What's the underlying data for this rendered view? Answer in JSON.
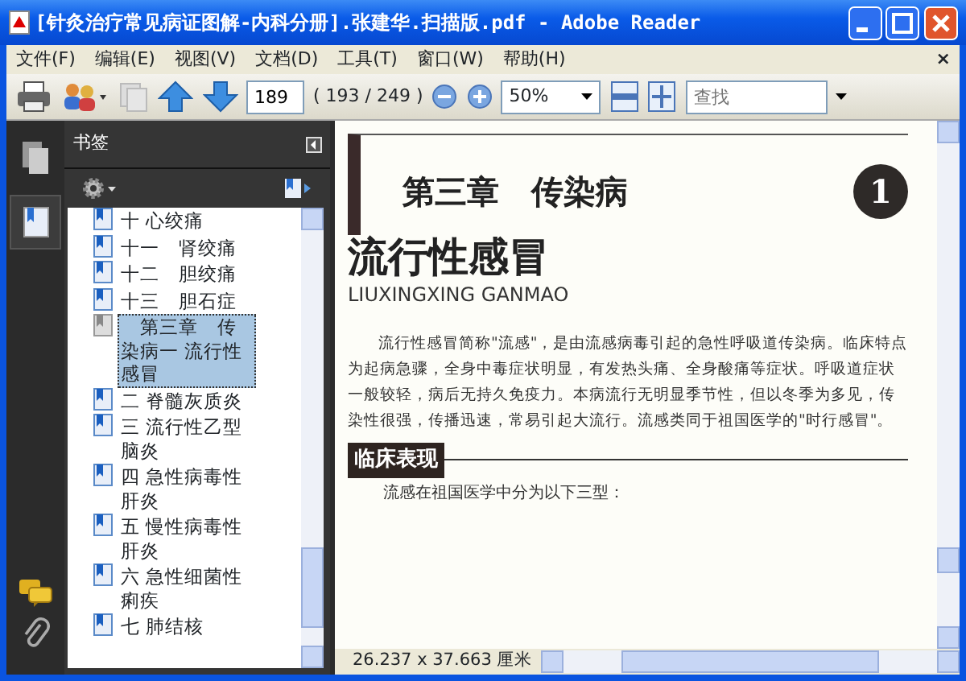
{
  "window": {
    "title": "[针灸治疗常见病证图解-内科分册].张建华.扫描版.pdf - Adobe Reader"
  },
  "menu": [
    {
      "label": "文件(F)"
    },
    {
      "label": "编辑(E)"
    },
    {
      "label": "视图(V)"
    },
    {
      "label": "文档(D)"
    },
    {
      "label": "工具(T)"
    },
    {
      "label": "窗口(W)"
    },
    {
      "label": "帮助(H)"
    }
  ],
  "menu_close": "×",
  "toolbar": {
    "page_field": {
      "value": "189"
    },
    "page_count": "( 193 / 249 )",
    "zoom": {
      "value": "50%"
    },
    "search": {
      "placeholder": "查找"
    }
  },
  "side_tabs": [
    {
      "kind": "pages",
      "selected": false
    },
    {
      "kind": "bookmarks",
      "selected": true
    }
  ],
  "bookmarks_panel": {
    "title": "书签",
    "items": [
      {
        "label": "十 心绞痛",
        "selected": false
      },
      {
        "label": "十一　肾绞痛",
        "selected": false
      },
      {
        "label": "十二　胆绞痛",
        "selected": false
      },
      {
        "label": "十三　胆石症",
        "selected": false
      },
      {
        "label": "　第三章　传染病一 流行性感冒",
        "selected": true
      },
      {
        "label": "二 脊髓灰质炎",
        "selected": false
      },
      {
        "label": "三 流行性乙型脑炎",
        "selected": false
      },
      {
        "label": "四 急性病毒性肝炎",
        "selected": false
      },
      {
        "label": "五 慢性病毒性肝炎",
        "selected": false
      },
      {
        "label": "六 急性细菌性痢疾",
        "selected": false
      },
      {
        "label": "七 肺结核",
        "selected": false
      }
    ]
  },
  "document": {
    "chapter_heading": "第三章　传染病",
    "chapter_number": "1",
    "title": "流行性感冒",
    "pinyin": "LIUXINGXING GANMAO",
    "paragraph": "流行性感冒简称\"流感\"，是由流感病毒引起的急性呼吸道传染病。临床特点为起病急骤，全身中毒症状明显，有发热头痛、全身酸痛等症状。呼吸道症状一般较轻，病后无持久免疫力。本病流行无明显季节性，但以冬季为多见，传染性很强，传播迅速，常易引起大流行。流感类同于祖国医学的\"时行感冒\"。",
    "section_heading": "临床表现",
    "body_line": "流感在祖国医学中分为以下三型："
  },
  "status_bar": {
    "page_size": "26.237 x 37.663 厘米"
  }
}
